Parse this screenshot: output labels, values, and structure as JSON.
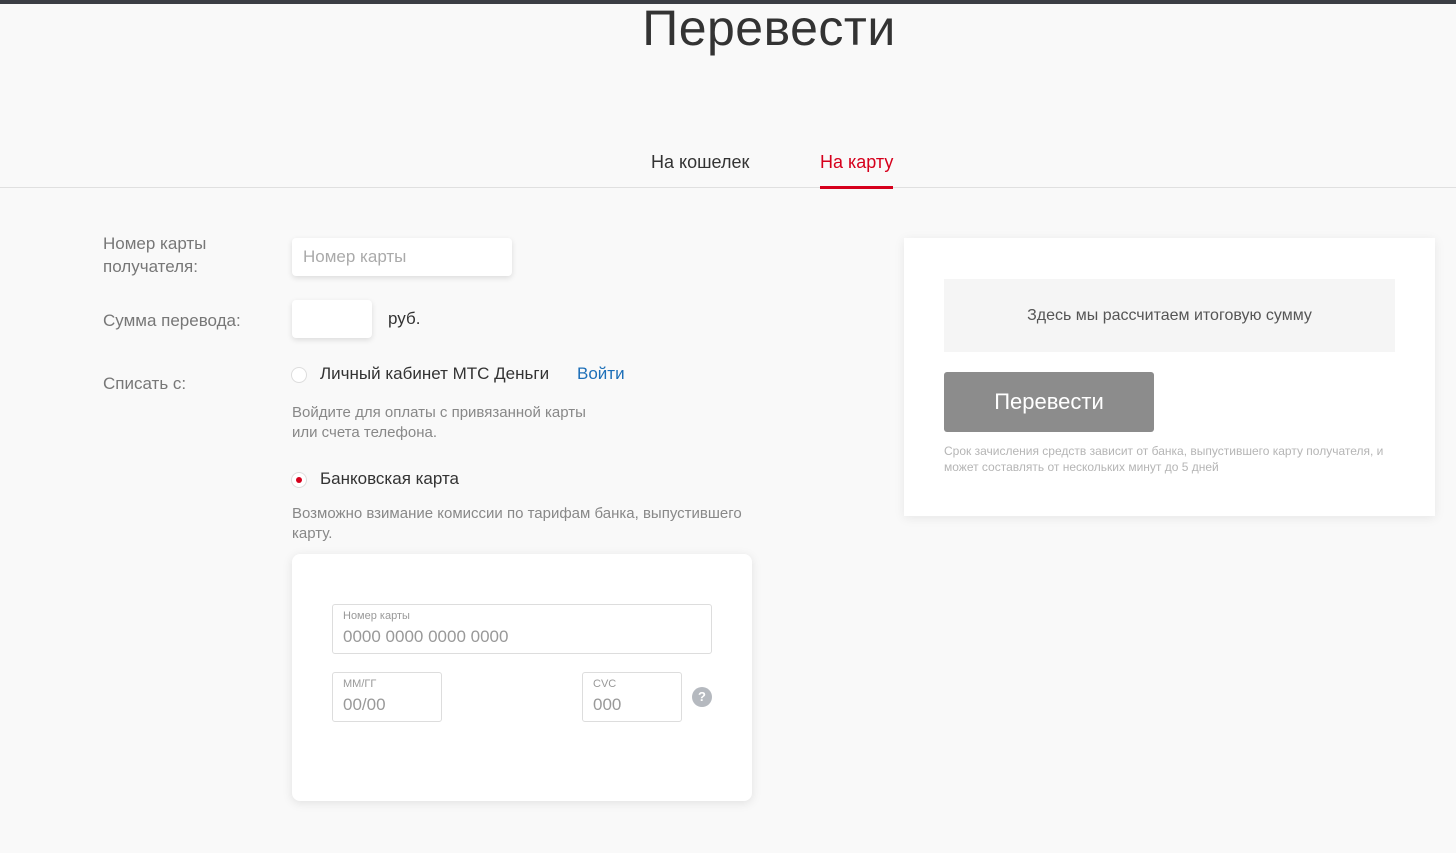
{
  "page": {
    "title": "Перевести"
  },
  "tabs": [
    {
      "label": "На кошелек",
      "active": false
    },
    {
      "label": "На карту",
      "active": true
    }
  ],
  "form": {
    "recipient_card_label": "Номер карты получателя:",
    "recipient_card_placeholder": "Номер карты",
    "amount_label": "Сумма перевода:",
    "amount_value": "",
    "currency": "руб.",
    "source_label": "Списать с:",
    "options": [
      {
        "label": "Личный кабинет МТС Деньги",
        "selected": false,
        "link": "Войти",
        "hint": "Войдите для оплаты с привязанной карты или счета телефона."
      },
      {
        "label": "Банковская карта",
        "selected": true,
        "hint": "Возможно взимание комиссии по тарифам банка, выпустившего карту."
      }
    ],
    "card": {
      "number_label": "Номер карты",
      "number_placeholder": "0000 0000 0000 0000",
      "expiry_label": "ММ/ГГ",
      "expiry_placeholder": "00/00",
      "cvc_label": "CVC",
      "cvc_placeholder": "000",
      "help_icon": "?"
    }
  },
  "summary": {
    "total_text": "Здесь мы рассчитаем итоговую сумму",
    "submit_label": "Перевести",
    "disclaimer": "Срок зачисления средств зависит от банка, выпустившего карту получателя, и может составлять от нескольких минут до 5 дней"
  },
  "colors": {
    "accent": "#d6001c",
    "link": "#1d6fb8",
    "button_disabled": "#8c8c8c"
  }
}
